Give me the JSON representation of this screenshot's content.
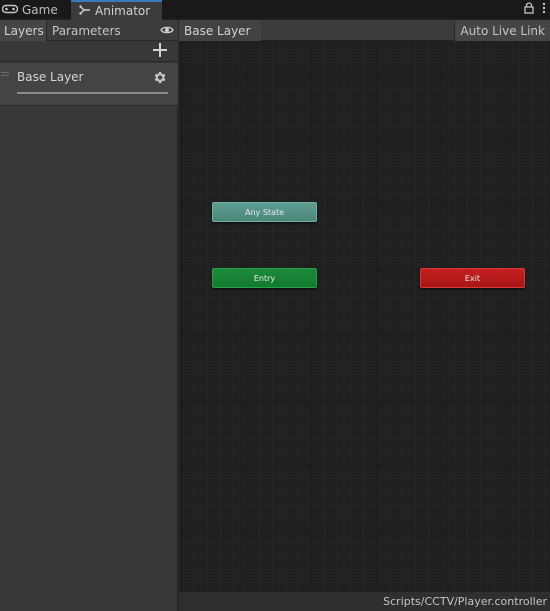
{
  "tabs": [
    {
      "label": "Game",
      "icon": "gamepad-icon"
    },
    {
      "label": "Animator",
      "icon": "animator-icon"
    }
  ],
  "left_panel": {
    "subtabs": {
      "layers": "Layers",
      "parameters": "Parameters"
    },
    "layers": [
      {
        "name": "Base Layer"
      }
    ]
  },
  "graph": {
    "breadcrumb": "Base Layer",
    "auto_live_link": "Auto Live Link",
    "nodes": {
      "any_state": "Any State",
      "entry": "Entry",
      "exit": "Exit"
    },
    "controller_path": "Scripts/CCTV/Player.controller"
  },
  "colors": {
    "any_state": "#55968a",
    "entry": "#178434",
    "exit": "#b81b1b",
    "active_tab_accent": "#3a79bb"
  }
}
